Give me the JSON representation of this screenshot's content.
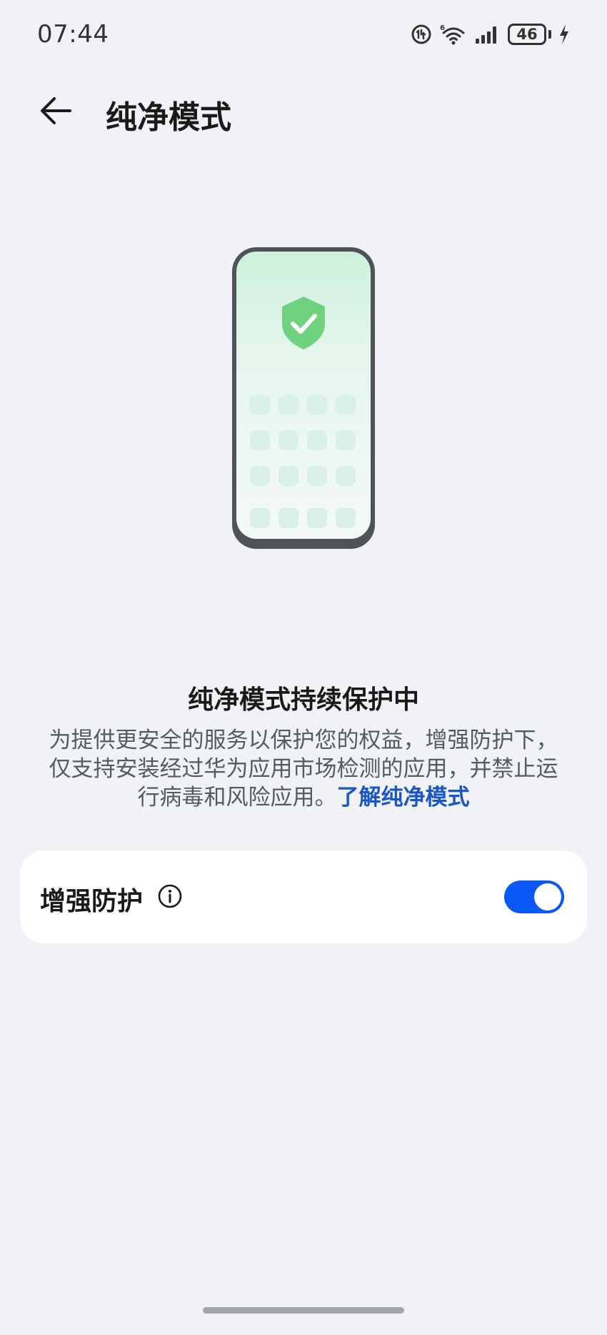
{
  "status_bar": {
    "time": "07:44",
    "battery_level": "46",
    "icons": [
      "hd-call-icon",
      "wifi-6-icon",
      "signal-icon",
      "battery-icon",
      "charging-icon"
    ]
  },
  "header": {
    "title": "纯净模式",
    "back_icon": "arrow-left-icon"
  },
  "illustration": {
    "icon": "shield-check-icon",
    "shield_color": "#6fd27f",
    "frame_color": "#4f5258"
  },
  "content": {
    "status_title": "纯净模式持续保护中",
    "description_lines": [
      "为提供更安全的服务以保护您的权益，增强防护下，",
      "仅支持安装经过华为应用市场检测的应用，并禁止运",
      "行病毒和风险应用。"
    ],
    "learn_more_link": "了解纯净模式"
  },
  "settings": {
    "enhanced_protection": {
      "label": "增强防护",
      "info_icon": "info-icon",
      "enabled": true,
      "toggle_color": "#0a59f7"
    }
  },
  "colors": {
    "background": "#f0f2f5",
    "card": "#ffffff",
    "link": "#1a56c7"
  }
}
